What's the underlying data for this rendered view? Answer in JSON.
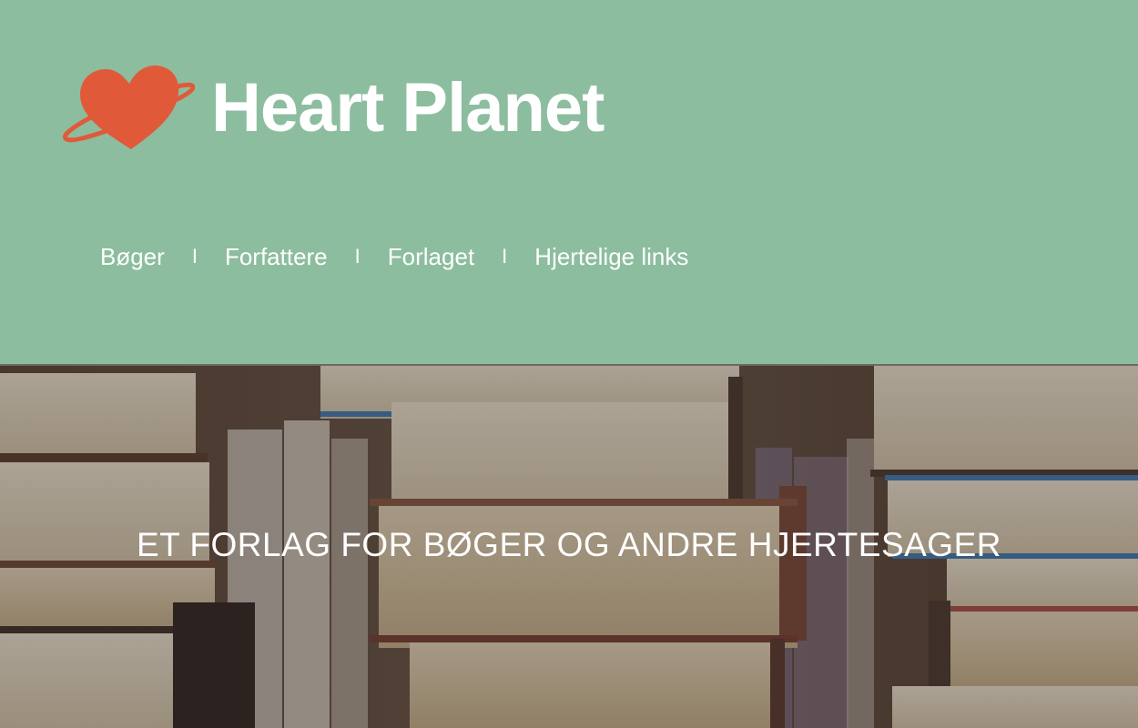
{
  "brand": {
    "name": "Heart Planet",
    "logo_icon": "heart-planet-logo-icon",
    "logo_color": "#e05a3a"
  },
  "nav": {
    "items": [
      {
        "label": "Bøger"
      },
      {
        "label": "Forfattere"
      },
      {
        "label": "Forlaget"
      },
      {
        "label": "Hjertelige links"
      }
    ],
    "separator": "I"
  },
  "hero": {
    "tagline": "ET FORLAG FOR BØGER OG ANDRE HJERTESAGER",
    "background": "stacked-books-photo"
  },
  "colors": {
    "header_bg": "#8cbd9f",
    "text": "#ffffff"
  }
}
